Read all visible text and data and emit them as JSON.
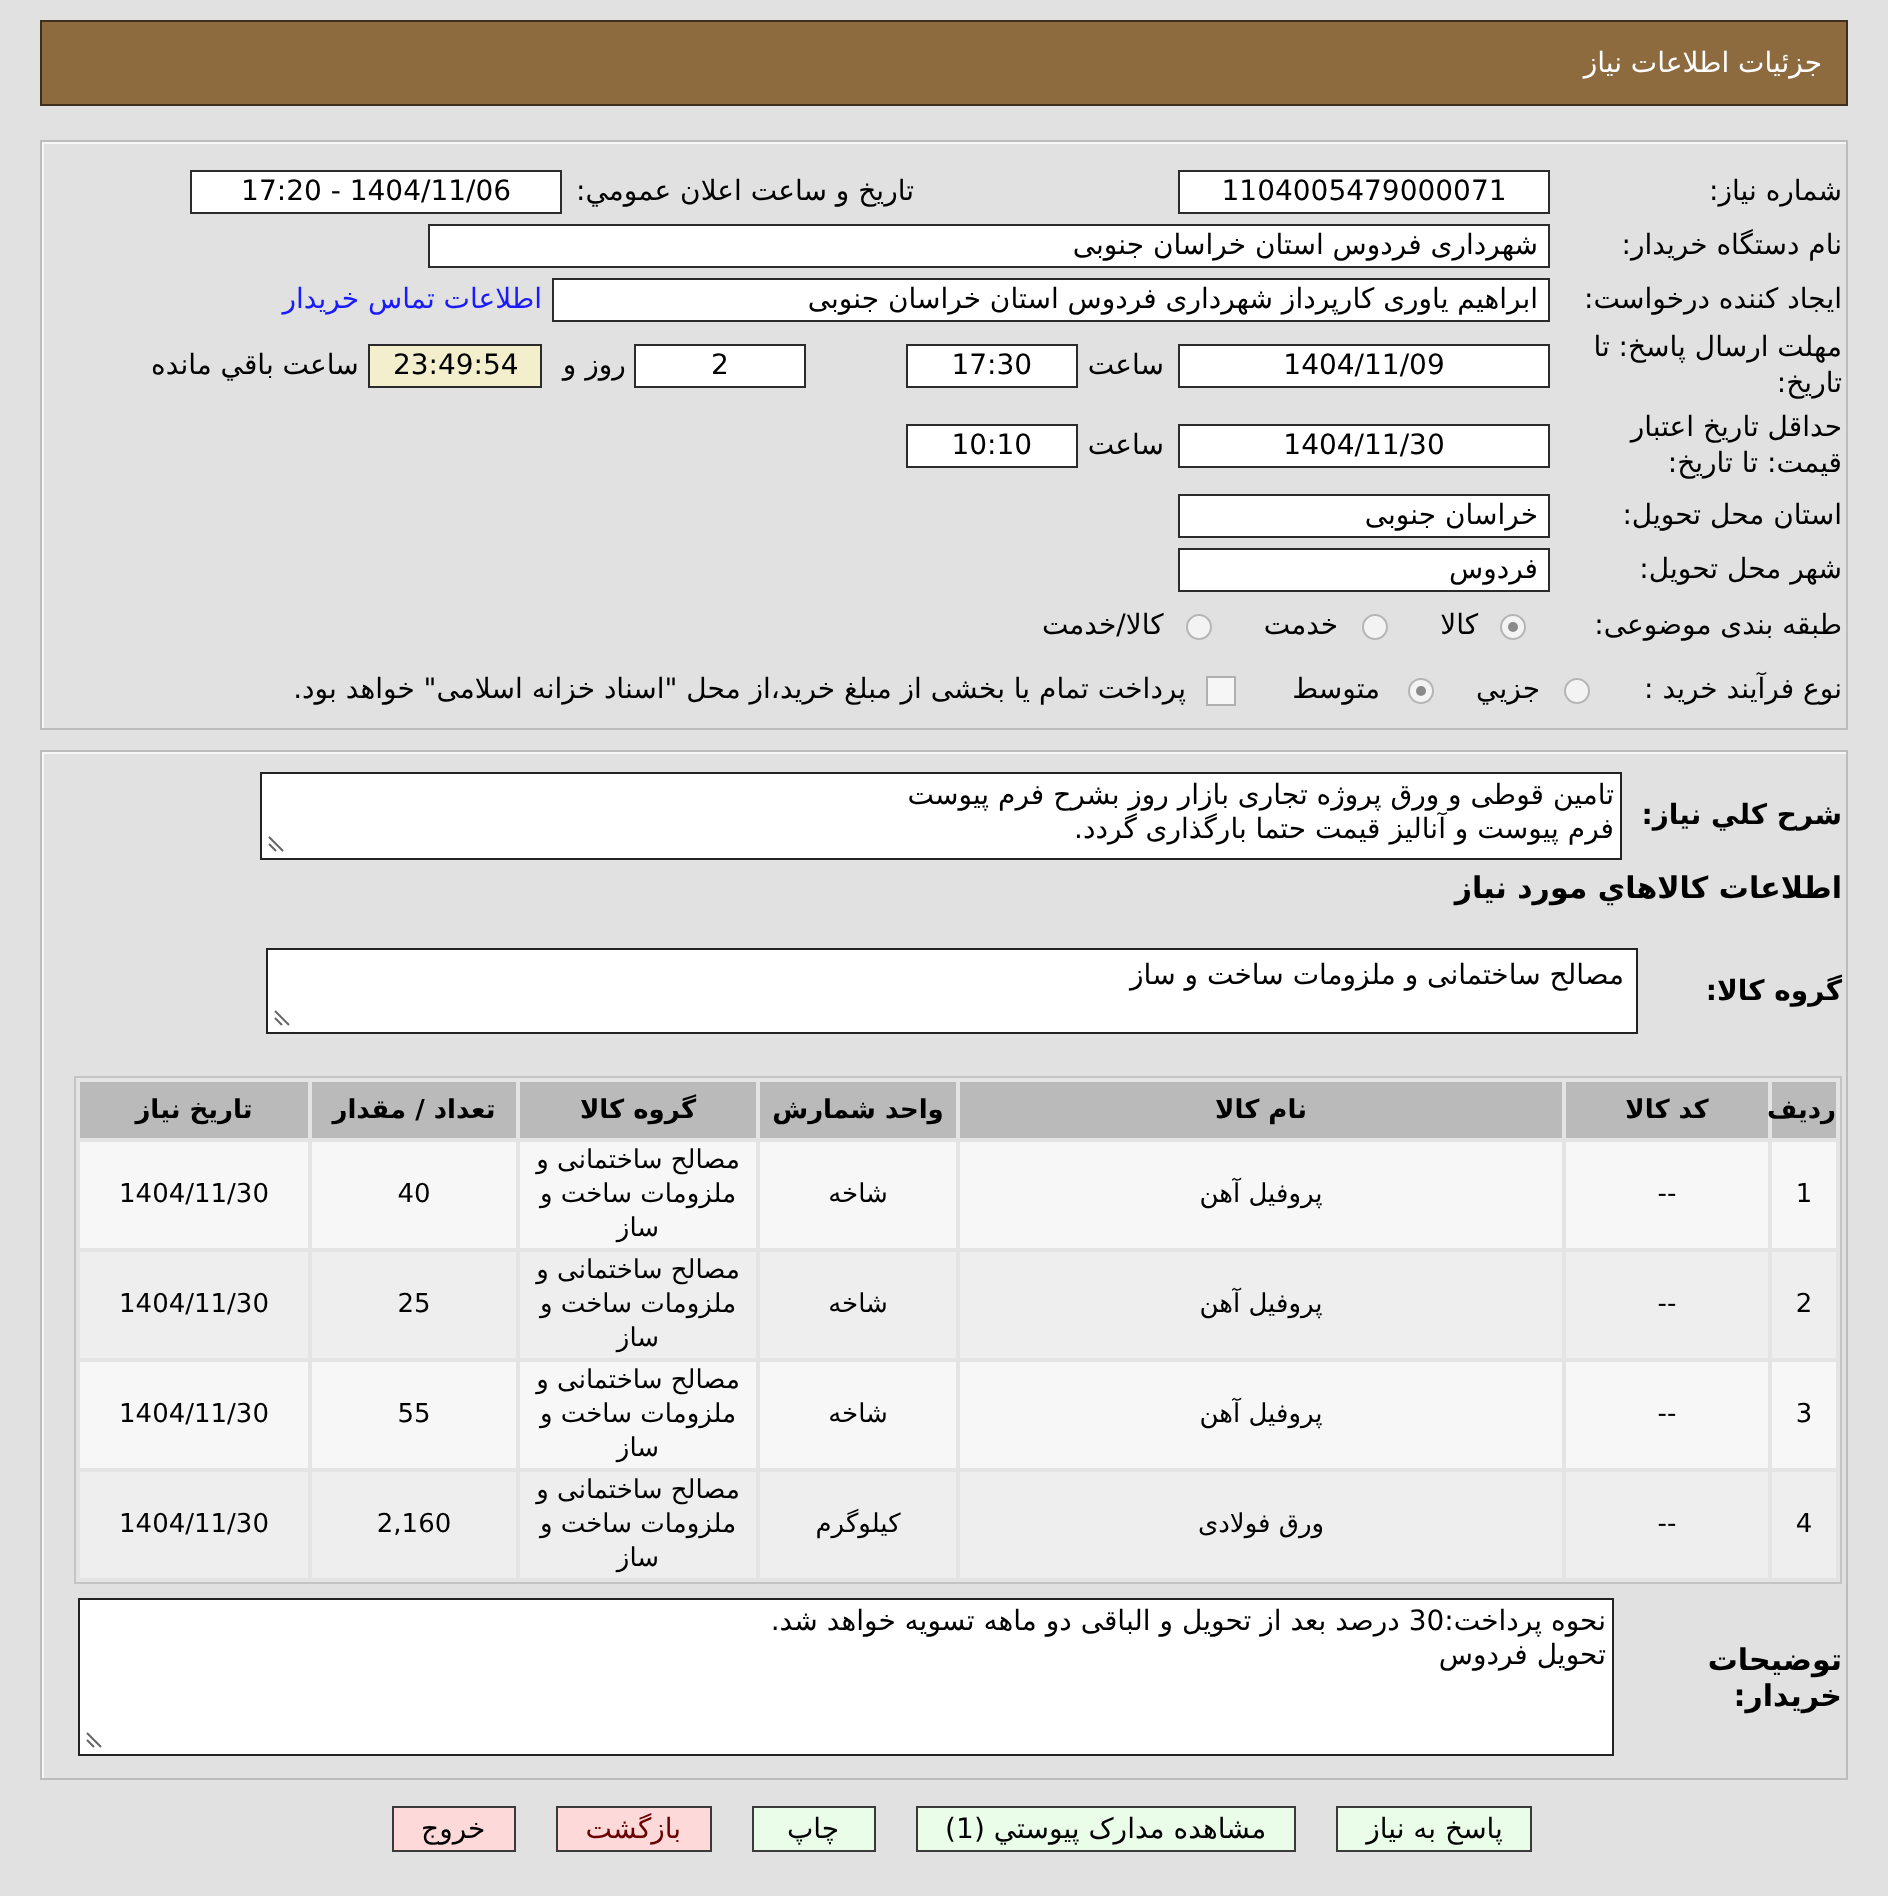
{
  "header": {
    "title": "جزئیات اطلاعات نیاز"
  },
  "details": {
    "need_number": {
      "label": "شماره نیاز:",
      "value": "1104005479000071"
    },
    "announce_date": {
      "label": "تاریخ و ساعت اعلان عمومي:",
      "value": "1404/11/06 - 17:20"
    },
    "buyer_org": {
      "label": "نام دستگاه خریدار:",
      "value": "شهرداری فردوس استان خراسان جنوبی"
    },
    "requester": {
      "label": "ایجاد کننده درخواست:",
      "value": "ابراهیم یاوری کارپرداز شهرداری فردوس استان خراسان جنوبی",
      "contact_link": "اطلاعات تماس خریدار"
    },
    "deadline": {
      "label": "مهلت ارسال پاسخ: تا تاریخ:",
      "date": "1404/11/09",
      "time_label": "ساعت",
      "time": "17:30",
      "days": "2",
      "days_label": "روز و",
      "remaining": "23:49:54",
      "remaining_label": "ساعت باقي مانده"
    },
    "price_validity": {
      "label": "حداقل تاریخ اعتبار قیمت: تا تاریخ:",
      "date": "1404/11/30",
      "time_label": "ساعت",
      "time": "10:10"
    },
    "delivery_province": {
      "label": "استان محل تحویل:",
      "value": "خراسان جنوبی"
    },
    "delivery_city": {
      "label": "شهر محل تحویل:",
      "value": "فردوس"
    },
    "subject_category": {
      "label": "طبقه بندی موضوعی:",
      "options": [
        {
          "label": "كالا",
          "selected": true
        },
        {
          "label": "خدمت",
          "selected": false
        },
        {
          "label": "كالا/خدمت",
          "selected": false
        }
      ]
    },
    "purchase_process": {
      "label": "نوع فرآیند خرید :",
      "options": [
        {
          "label": "جزيي",
          "selected": false
        },
        {
          "label": "متوسط",
          "selected": true
        }
      ],
      "treasury_payment": {
        "checked": false,
        "label": "پرداخت تمام یا بخشی از مبلغ خرید،از محل \"اسناد خزانه اسلامی\" خواهد بود."
      }
    }
  },
  "description": {
    "label": "شرح كلي نياز:",
    "text": "تامین قوطی و ورق پروژه تجاری بازار روز بشرح فرم پیوست\nفرم پیوست و آنالیز قیمت حتما بارگذاری گردد."
  },
  "goods": {
    "title": "اطلاعات كالاهاي مورد نياز",
    "group_label": "گروه كالا:",
    "group_value": "مصالح ساختمانی و ملزومات ساخت و ساز",
    "table": {
      "columns": [
        "ردیف",
        "کد کالا",
        "نام کالا",
        "واحد شمارش",
        "گروه کالا",
        "تعداد / مقدار",
        "تاریخ نیاز"
      ],
      "rows": [
        {
          "row_number": "1",
          "item_code": "--",
          "item_name": "پروفیل آهن",
          "unit": "شاخه",
          "item_group": "مصالح ساختمانی و ملزومات ساخت و ساز",
          "quantity": "40",
          "need_date": "1404/11/30"
        },
        {
          "row_number": "2",
          "item_code": "--",
          "item_name": "پروفیل آهن",
          "unit": "شاخه",
          "item_group": "مصالح ساختمانی و ملزومات ساخت و ساز",
          "quantity": "25",
          "need_date": "1404/11/30"
        },
        {
          "row_number": "3",
          "item_code": "--",
          "item_name": "پروفیل آهن",
          "unit": "شاخه",
          "item_group": "مصالح ساختمانی و ملزومات ساخت و ساز",
          "quantity": "55",
          "need_date": "1404/11/30"
        },
        {
          "row_number": "4",
          "item_code": "--",
          "item_name": "ورق فولادی",
          "unit": "کیلوگرم",
          "item_group": "مصالح ساختمانی و ملزومات ساخت و ساز",
          "quantity": "2,160",
          "need_date": "1404/11/30"
        }
      ]
    }
  },
  "buyer_notes": {
    "label": "توضیحات خریدار:",
    "text": "نحوه پرداخت:30 درصد بعد از تحویل و الباقی دو ماهه تسویه خواهد شد.\nتحویل فردوس"
  },
  "buttons": [
    {
      "label": "پاسخ به نیاز",
      "kind": "action"
    },
    {
      "label": "مشاهده مدارک پیوستي (1)",
      "kind": "action"
    },
    {
      "label": "چاپ",
      "kind": "action"
    },
    {
      "label": "بازگشت",
      "kind": "back"
    },
    {
      "label": "خروج",
      "kind": "exit"
    }
  ]
}
